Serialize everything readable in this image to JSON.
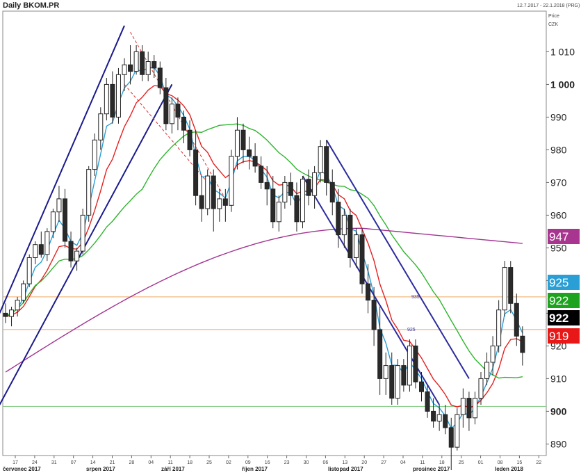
{
  "chart_data": {
    "type": "candlestick",
    "title": "Daily BKOM.PR",
    "date_range": "12.7.2017 - 22.1.2018 (PRG)",
    "yaxis_title": [
      "Price",
      "CZK"
    ],
    "ylim": [
      880,
      1015
    ],
    "yticks": [
      1010,
      1000,
      990,
      980,
      970,
      960,
      950,
      940,
      930,
      920,
      910,
      900,
      890
    ],
    "ytick_bold": [
      1000,
      900
    ],
    "day_ticks": [
      "17",
      "24",
      "31",
      "07",
      "14",
      "21",
      "28",
      "04",
      "11",
      "18",
      "25",
      "02",
      "09",
      "16",
      "23",
      "30",
      "06",
      "13",
      "20",
      "27",
      "04",
      "11",
      "18",
      "25",
      "01",
      "08",
      "15",
      "22"
    ],
    "months": [
      "červenec 2017",
      "srpen 2017",
      "září 2017",
      "říjen 2017",
      "listopad 2017",
      "prosinec 2017",
      "leden 2018"
    ],
    "month_start_index": [
      0,
      4,
      8,
      12,
      16,
      20,
      24
    ],
    "candles": [
      [
        0,
        930,
        933,
        927,
        929
      ],
      [
        1,
        929,
        932,
        926,
        931
      ],
      [
        2,
        931,
        935,
        929,
        934
      ],
      [
        3,
        934,
        940,
        933,
        939
      ],
      [
        4,
        939,
        948,
        938,
        947
      ],
      [
        5,
        947,
        952,
        945,
        951
      ],
      [
        6,
        951,
        955,
        947,
        948
      ],
      [
        7,
        948,
        956,
        946,
        955
      ],
      [
        8,
        955,
        962,
        953,
        961
      ],
      [
        9,
        961,
        969,
        958,
        965
      ],
      [
        10,
        965,
        968,
        950,
        952
      ],
      [
        11,
        952,
        955,
        944,
        946
      ],
      [
        12,
        946,
        950,
        943,
        949
      ],
      [
        13,
        949,
        962,
        948,
        960
      ],
      [
        14,
        960,
        975,
        958,
        974
      ],
      [
        15,
        974,
        985,
        972,
        983
      ],
      [
        16,
        983,
        993,
        980,
        991
      ],
      [
        17,
        991,
        1002,
        989,
        1000
      ],
      [
        18,
        1000,
        1004,
        988,
        990
      ],
      [
        19,
        990,
        1005,
        988,
        1003
      ],
      [
        20,
        1003,
        1008,
        998,
        1006
      ],
      [
        21,
        1006,
        1012,
        1000,
        1004
      ],
      [
        22,
        1004,
        1012,
        1003,
        1010
      ],
      [
        23,
        1010,
        1012,
        1001,
        1003
      ],
      [
        24,
        1003,
        1010,
        1001,
        1007
      ],
      [
        25,
        1007,
        1009,
        1002,
        1005
      ],
      [
        26,
        1005,
        1007,
        997,
        999
      ],
      [
        27,
        999,
        1002,
        986,
        988
      ],
      [
        28,
        988,
        996,
        985,
        994
      ],
      [
        29,
        994,
        996,
        986,
        990
      ],
      [
        30,
        990,
        992,
        982,
        986
      ],
      [
        31,
        986,
        989,
        978,
        980
      ],
      [
        32,
        980,
        986,
        963,
        966
      ],
      [
        33,
        966,
        972,
        958,
        962
      ],
      [
        34,
        962,
        974,
        960,
        972
      ],
      [
        35,
        972,
        974,
        955,
        962
      ],
      [
        36,
        962,
        968,
        958,
        965
      ],
      [
        37,
        965,
        968,
        958,
        963
      ],
      [
        38,
        963,
        980,
        961,
        978
      ],
      [
        39,
        978,
        990,
        974,
        986
      ],
      [
        40,
        986,
        988,
        976,
        980
      ],
      [
        41,
        980,
        984,
        974,
        978
      ],
      [
        42,
        978,
        982,
        973,
        975
      ],
      [
        43,
        975,
        978,
        968,
        970
      ],
      [
        44,
        970,
        975,
        963,
        968
      ],
      [
        45,
        968,
        972,
        956,
        958
      ],
      [
        46,
        958,
        966,
        955,
        964
      ],
      [
        47,
        964,
        972,
        962,
        970
      ],
      [
        48,
        970,
        973,
        963,
        966
      ],
      [
        49,
        966,
        970,
        955,
        958
      ],
      [
        50,
        958,
        972,
        956,
        971
      ],
      [
        51,
        971,
        974,
        963,
        966
      ],
      [
        52,
        966,
        975,
        962,
        973
      ],
      [
        53,
        973,
        983,
        970,
        981
      ],
      [
        54,
        981,
        983,
        966,
        970
      ],
      [
        55,
        970,
        974,
        960,
        964
      ],
      [
        56,
        964,
        968,
        950,
        954
      ],
      [
        57,
        954,
        962,
        950,
        960
      ],
      [
        58,
        960,
        962,
        944,
        947
      ],
      [
        59,
        947,
        956,
        944,
        954
      ],
      [
        60,
        954,
        956,
        936,
        939
      ],
      [
        61,
        939,
        945,
        930,
        934
      ],
      [
        62,
        934,
        938,
        920,
        925
      ],
      [
        63,
        925,
        932,
        905,
        910
      ],
      [
        64,
        910,
        918,
        905,
        914
      ],
      [
        65,
        914,
        918,
        902,
        904
      ],
      [
        66,
        904,
        916,
        902,
        914
      ],
      [
        67,
        914,
        916,
        906,
        908
      ],
      [
        68,
        908,
        922,
        906,
        920
      ],
      [
        69,
        920,
        922,
        907,
        909
      ],
      [
        70,
        909,
        912,
        903,
        906
      ],
      [
        71,
        906,
        908,
        898,
        900
      ],
      [
        72,
        900,
        904,
        895,
        897
      ],
      [
        73,
        897,
        902,
        894,
        899
      ],
      [
        74,
        899,
        902,
        893,
        895
      ],
      [
        75,
        895,
        898,
        882,
        889
      ],
      [
        76,
        889,
        901,
        888,
        899
      ],
      [
        77,
        899,
        907,
        895,
        904
      ],
      [
        78,
        904,
        906,
        894,
        898
      ],
      [
        79,
        898,
        906,
        896,
        904
      ],
      [
        80,
        904,
        912,
        902,
        910
      ],
      [
        81,
        910,
        918,
        908,
        915
      ],
      [
        82,
        915,
        923,
        911,
        920
      ],
      [
        83,
        920,
        934,
        918,
        931
      ],
      [
        84,
        931,
        946,
        929,
        944
      ],
      [
        85,
        944,
        946,
        930,
        933
      ],
      [
        86,
        933,
        936,
        920,
        923
      ],
      [
        87,
        923,
        926,
        914,
        918
      ]
    ],
    "series": [
      {
        "name": "MA short",
        "color": "#2a9fd6",
        "label": "925",
        "label_bg": "#2a9fd6",
        "label_color": "#ffffff"
      },
      {
        "name": "MA medium",
        "color": "#e52020",
        "label": "919",
        "label_bg": "#e81818",
        "label_color": "#ffffff"
      },
      {
        "name": "MA long",
        "color": "#2db52d",
        "label": "922",
        "label_bg": "#1ea31e",
        "label_color": "#ffffff"
      },
      {
        "name": "MA 200",
        "color": "#a23592",
        "label": "947",
        "label_bg": "#a8358f",
        "label_color": "#ffffff"
      }
    ],
    "price_label": {
      "value": "922",
      "bg": "#000000",
      "color": "#ffffff"
    },
    "horizontal_lines": [
      {
        "value": 935,
        "color": "#f0a860",
        "label": "935"
      },
      {
        "value": 925,
        "color": "#f0a860",
        "label": "925"
      },
      {
        "value": 901.5,
        "color": "#7fc97f",
        "label": ""
      }
    ],
    "trendlines": [
      {
        "color": "#1a1a8c",
        "style": "solid",
        "points": [
          [
            -1,
            930
          ],
          [
            20,
            1018
          ]
        ]
      },
      {
        "color": "#1a1a8c",
        "style": "solid",
        "points": [
          [
            -1,
            902
          ],
          [
            28,
            1000
          ]
        ]
      },
      {
        "color": "#d93030",
        "style": "dashed",
        "points": [
          [
            21,
            1016
          ],
          [
            37,
            965
          ]
        ]
      },
      {
        "color": "#d93030",
        "style": "dashed",
        "points": [
          [
            20,
            1000
          ],
          [
            34,
            970
          ]
        ]
      },
      {
        "color": "#2b2b9e",
        "style": "solid",
        "points": [
          [
            54,
            983
          ],
          [
            78,
            910
          ]
        ]
      },
      {
        "color": "#2b2b9e",
        "style": "solid",
        "points": [
          [
            50,
            972
          ],
          [
            73,
            902
          ]
        ]
      }
    ],
    "grid": false
  }
}
